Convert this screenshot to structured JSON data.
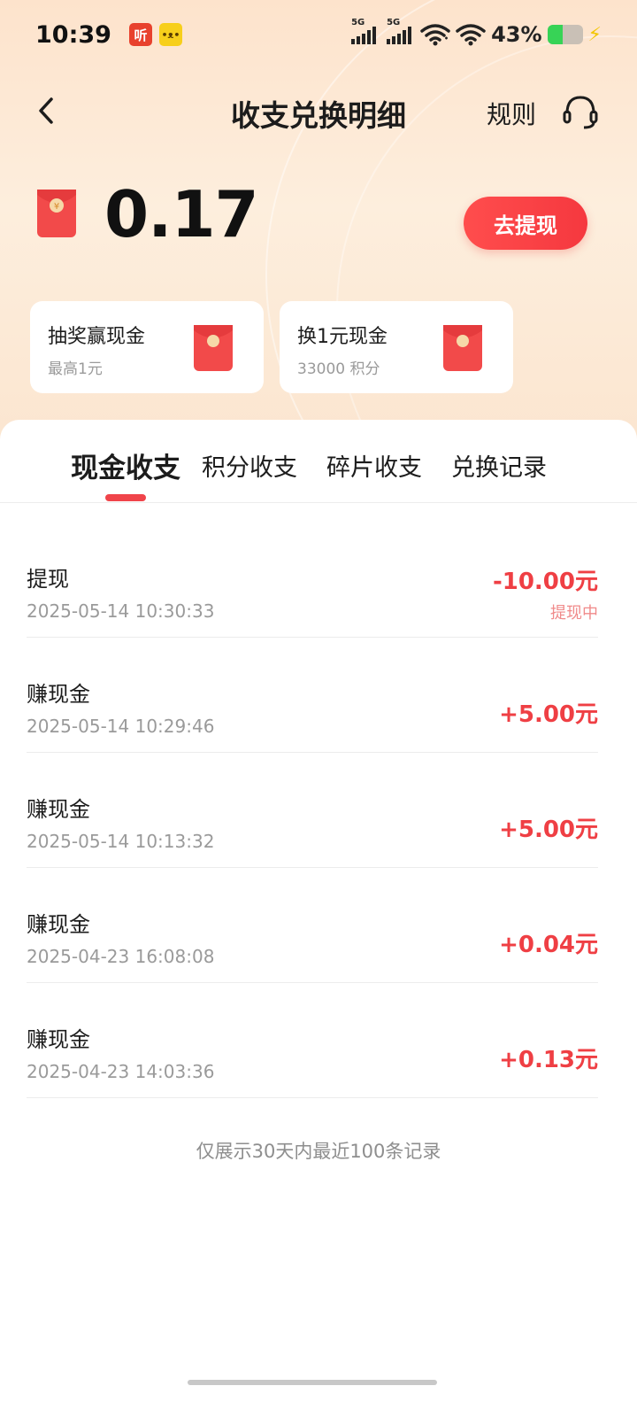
{
  "status_bar": {
    "time": "10:39",
    "app_badges": [
      {
        "icon": "ximalaya-listen-icon",
        "label": "听"
      },
      {
        "icon": "dog-app-icon",
        "label": ""
      }
    ],
    "signal_labels": [
      "5G",
      "5G"
    ],
    "battery_percent": "43%",
    "battery_level": 0.43
  },
  "header": {
    "title": "收支兑换明细",
    "rules_label": "规则",
    "back_icon": "chevron-left-icon",
    "service_icon": "headset-icon"
  },
  "balance": {
    "value": "0.17",
    "withdraw_label": "去提现"
  },
  "promos": [
    {
      "title": "抽奖赢现金",
      "subtitle": "最高1元"
    },
    {
      "title": "换1元现金",
      "subtitle": "33000 积分"
    }
  ],
  "tabs": [
    {
      "label": "现金收支",
      "active": true
    },
    {
      "label": "积分收支",
      "active": false
    },
    {
      "label": "碎片收支",
      "active": false
    },
    {
      "label": "兑换记录",
      "active": false
    }
  ],
  "records": [
    {
      "name": "提现",
      "time": "2025-05-14 10:30:33",
      "amount": "-10.00元",
      "status": "提现中"
    },
    {
      "name": "赚现金",
      "time": "2025-05-14 10:29:46",
      "amount": "+5.00元",
      "status": ""
    },
    {
      "name": "赚现金",
      "time": "2025-05-14 10:13:32",
      "amount": "+5.00元",
      "status": ""
    },
    {
      "name": "赚现金",
      "time": "2025-04-23 16:08:08",
      "amount": "+0.04元",
      "status": ""
    },
    {
      "name": "赚现金",
      "time": "2025-04-23 14:03:36",
      "amount": "+0.13元",
      "status": ""
    }
  ],
  "footer_note": "仅展示30天内最近100条记录",
  "colors": {
    "accent": "#f0444a",
    "amount": "#ef3f44",
    "header_bg": "#fde3cc"
  }
}
